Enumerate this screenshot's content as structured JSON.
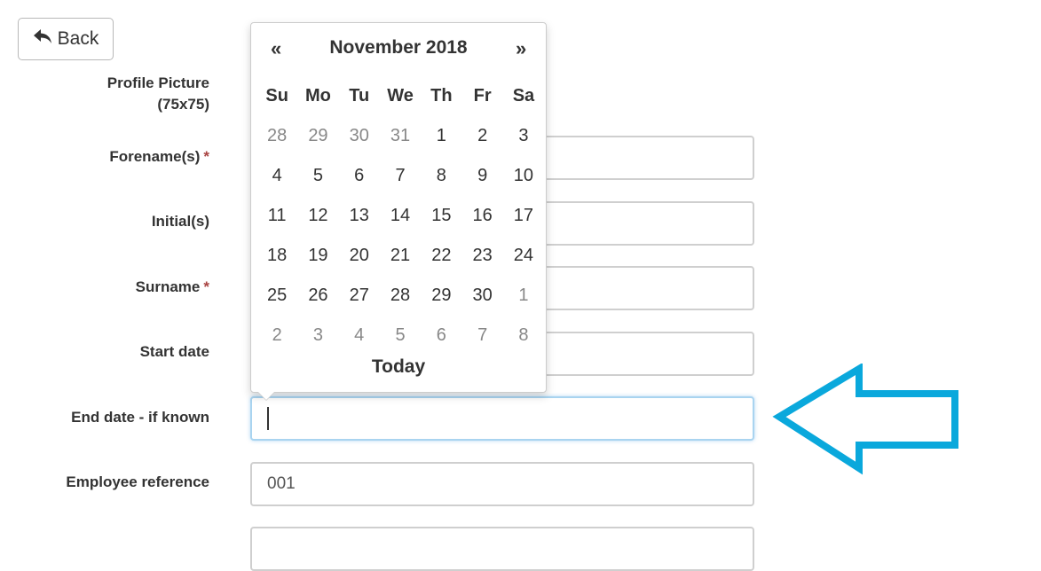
{
  "back_button": {
    "label": "Back",
    "icon": "reply-arrow-icon"
  },
  "form": {
    "fields": [
      {
        "label": "Profile Picture",
        "label2": "(75x75)",
        "required": false
      },
      {
        "label": "Forename(s)",
        "required": true,
        "value": ""
      },
      {
        "label": "Initial(s)",
        "required": false,
        "value": ""
      },
      {
        "label": "Surname",
        "required": true,
        "value": ""
      },
      {
        "label": "Start date",
        "required": false,
        "value": ""
      },
      {
        "label": "End date - if known",
        "required": false,
        "value": ""
      },
      {
        "label": "Employee reference",
        "required": false,
        "value": "001"
      }
    ],
    "required_mark": "*"
  },
  "datepicker": {
    "prev": "«",
    "next": "»",
    "month_year": "November 2018",
    "weekdays": [
      "Su",
      "Mo",
      "Tu",
      "We",
      "Th",
      "Fr",
      "Sa"
    ],
    "weeks": [
      [
        "28",
        "29",
        "30",
        "31",
        "1",
        "2",
        "3"
      ],
      [
        "4",
        "5",
        "6",
        "7",
        "8",
        "9",
        "10"
      ],
      [
        "11",
        "12",
        "13",
        "14",
        "15",
        "16",
        "17"
      ],
      [
        "18",
        "19",
        "20",
        "21",
        "22",
        "23",
        "24"
      ],
      [
        "25",
        "26",
        "27",
        "28",
        "29",
        "30",
        "1"
      ],
      [
        "2",
        "3",
        "4",
        "5",
        "6",
        "7",
        "8"
      ]
    ],
    "today_label": "Today"
  },
  "colors": {
    "annotation_arrow": "#0aa8dc",
    "required": "#a94442",
    "focus_border": "#a9d4f0"
  }
}
